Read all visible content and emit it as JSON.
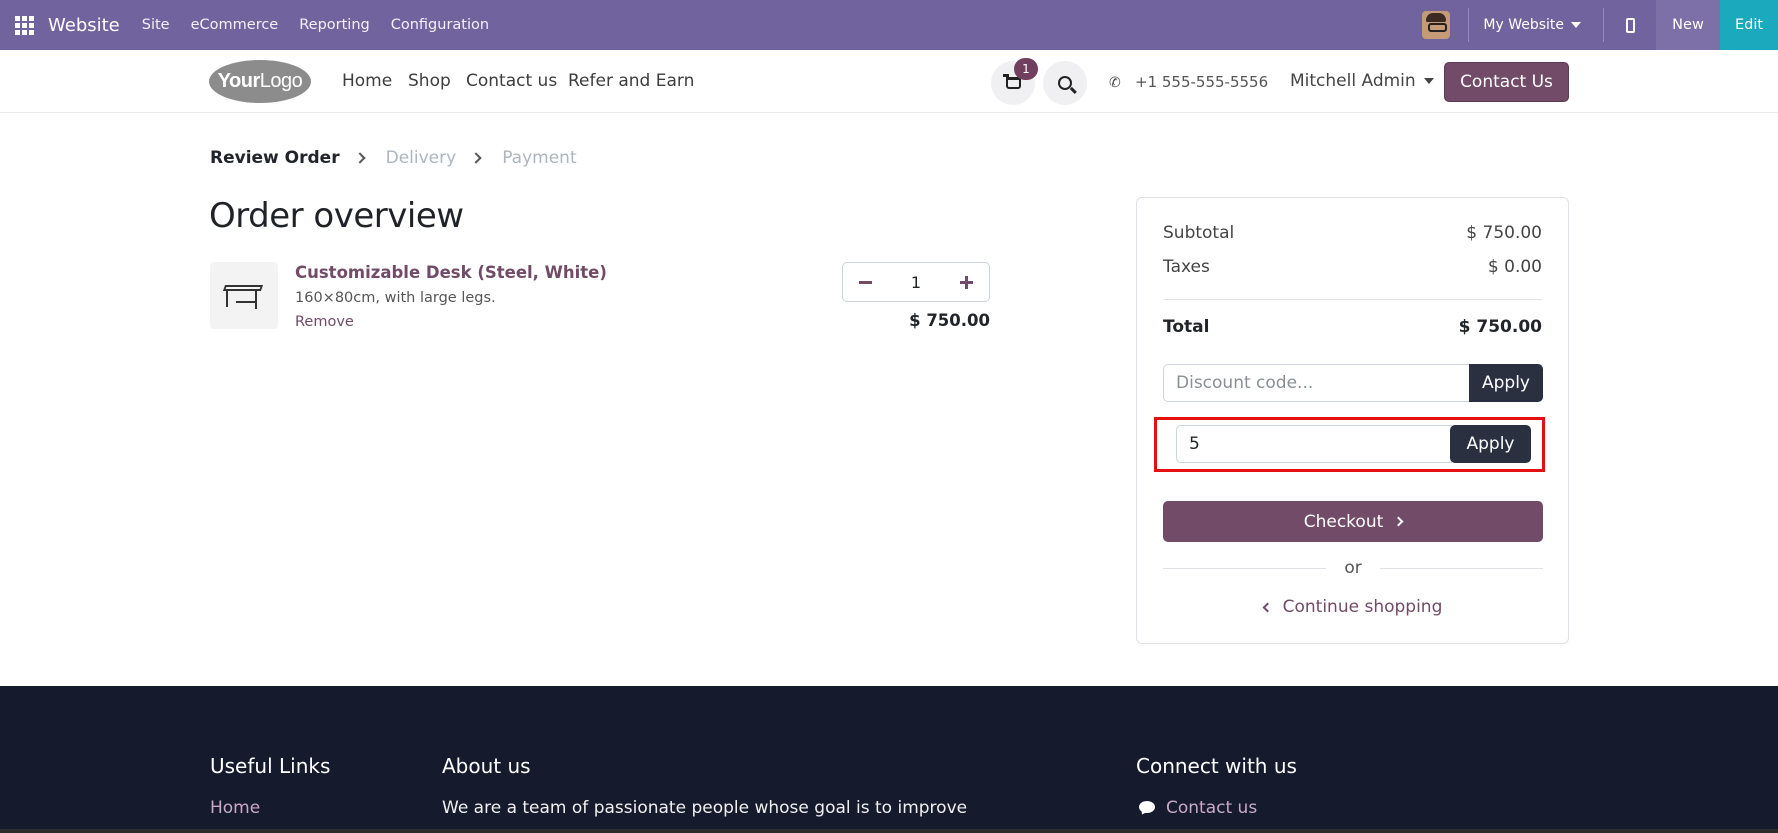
{
  "topbar": {
    "app_name": "Website",
    "menus": [
      "Site",
      "eCommerce",
      "Reporting",
      "Configuration"
    ],
    "website_selector": "My Website",
    "new_label": "New",
    "edit_label": "Edit",
    "icons": {
      "apps": "apps-grid-icon",
      "avatar": "user-avatar",
      "mobile": "mobile-preview-icon"
    }
  },
  "header": {
    "logo_bold": "Your",
    "logo_light": "Logo",
    "nav": [
      "Home",
      "Shop",
      "Contact us",
      "Refer and Earn"
    ],
    "cart_count": "1",
    "phone": "+1 555-555-5556",
    "user": "Mitchell Admin",
    "contact_button": "Contact Us"
  },
  "checkout": {
    "steps": [
      "Review Order",
      "Delivery",
      "Payment"
    ],
    "active_step": "Review Order",
    "title": "Order overview",
    "lines": [
      {
        "name": "Customizable Desk (Steel, White)",
        "description": "160×80cm, with large legs.",
        "remove_label": "Remove",
        "quantity": "1",
        "price": "$ 750.00"
      }
    ]
  },
  "summary": {
    "subtotal_label": "Subtotal",
    "subtotal_value": "$ 750.00",
    "taxes_label": "Taxes",
    "taxes_value": "$ 0.00",
    "total_label": "Total",
    "total_value": "$ 750.00",
    "discount_placeholder": "Discount code...",
    "apply_label": "Apply",
    "code_value": "5",
    "code_apply_label": "Apply",
    "checkout_label": "Checkout",
    "or_label": "or",
    "continue_label": "Continue shopping"
  },
  "footer": {
    "useful_links_title": "Useful Links",
    "useful_links": [
      "Home"
    ],
    "about_title": "About us",
    "about_text": "We are a team of passionate people whose goal is to improve",
    "connect_title": "Connect with us",
    "connect_link": "Contact us"
  },
  "colors": {
    "topbar": "#71639e",
    "brand_primary": "#714b67",
    "dark_button": "#2b3041",
    "edit_button": "#1aa9bd",
    "footer_bg": "#151b2d",
    "highlight_border": "#e50f0f"
  }
}
